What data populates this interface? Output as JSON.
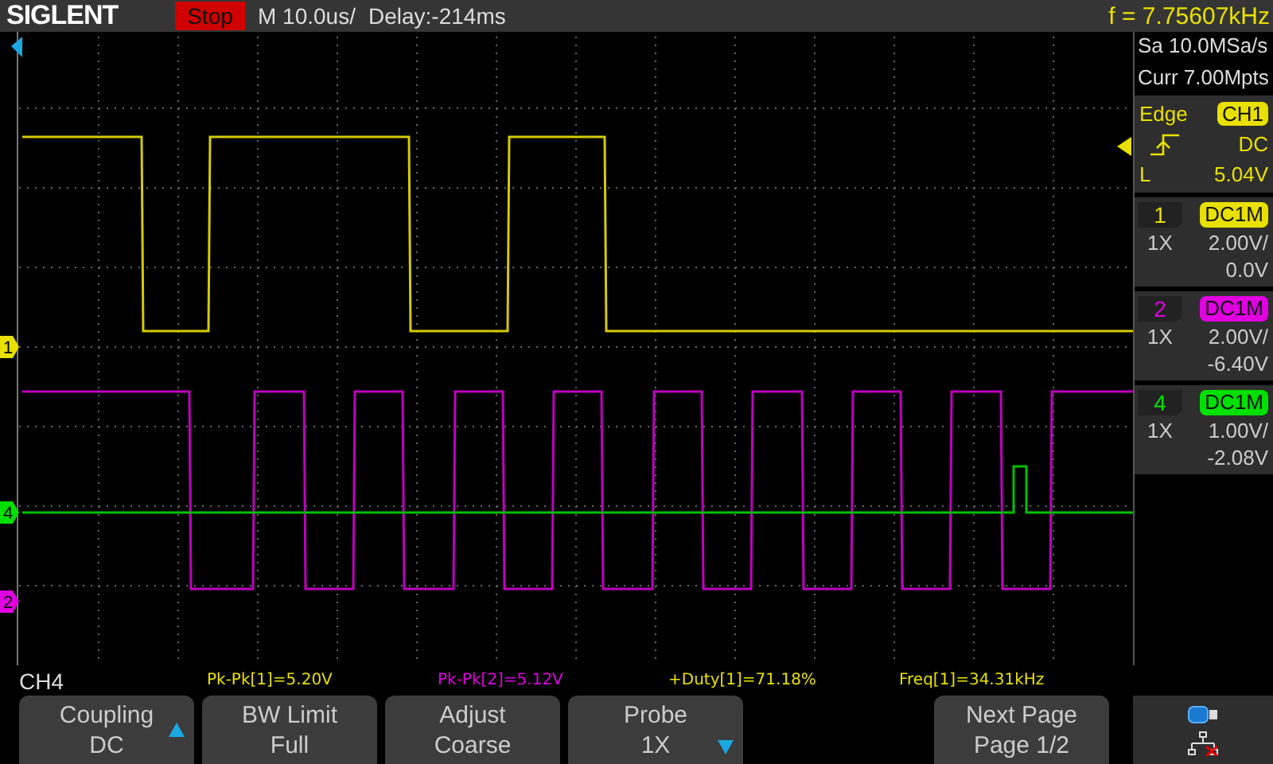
{
  "header": {
    "brand": "SIGLENT",
    "run_state": "Stop",
    "timebase": "M 10.0us/",
    "delay": "Delay:-214ms",
    "frequency": "f = 7.75607kHz"
  },
  "acquisition": {
    "sample_rate": "Sa 10.0MSa/s",
    "memory": "Curr 7.00Mpts"
  },
  "trigger": {
    "type": "Edge",
    "source": "CH1",
    "coupling": "DC",
    "level_label": "L",
    "level": "5.04V"
  },
  "channels": [
    {
      "number": "1",
      "coupling": "DC1M",
      "probe": "1X",
      "scale": "2.00V/",
      "offset": "0.0V",
      "color": "#e8e000"
    },
    {
      "number": "2",
      "coupling": "DC1M",
      "probe": "1X",
      "scale": "2.00V/",
      "offset": "-6.40V",
      "color": "#e000e0"
    },
    {
      "number": "4",
      "coupling": "DC1M",
      "probe": "1X",
      "scale": "1.00V/",
      "offset": "-2.08V",
      "color": "#00e000"
    }
  ],
  "markers": [
    {
      "label": "1",
      "color": "#e8e000"
    },
    {
      "label": "4",
      "color": "#00e000"
    },
    {
      "label": "2",
      "color": "#e000e0"
    }
  ],
  "menu_title": "CH4",
  "measurements": [
    {
      "text": "Pk-Pk[1]=5.20V",
      "color": "#e8e000"
    },
    {
      "text": "Pk-Pk[2]=5.12V",
      "color": "#e000e0"
    },
    {
      "text": "+Duty[1]=71.18%",
      "color": "#e8e000"
    },
    {
      "text": "Freq[1]=34.31kHz",
      "color": "#e8e000"
    }
  ],
  "softkeys": [
    {
      "title": "Coupling",
      "value": "DC",
      "scroll_up": true,
      "scroll_down": false
    },
    {
      "title": "BW Limit",
      "value": "Full",
      "scroll_up": false,
      "scroll_down": false
    },
    {
      "title": "Adjust",
      "value": "Coarse",
      "scroll_up": false,
      "scroll_down": false
    },
    {
      "title": "Probe",
      "value": "1X",
      "scroll_up": false,
      "scroll_down": true
    },
    {
      "kind": "blank"
    },
    {
      "title": "Next Page",
      "value": "Page 1/2",
      "scroll_up": false,
      "scroll_down": false
    }
  ]
}
